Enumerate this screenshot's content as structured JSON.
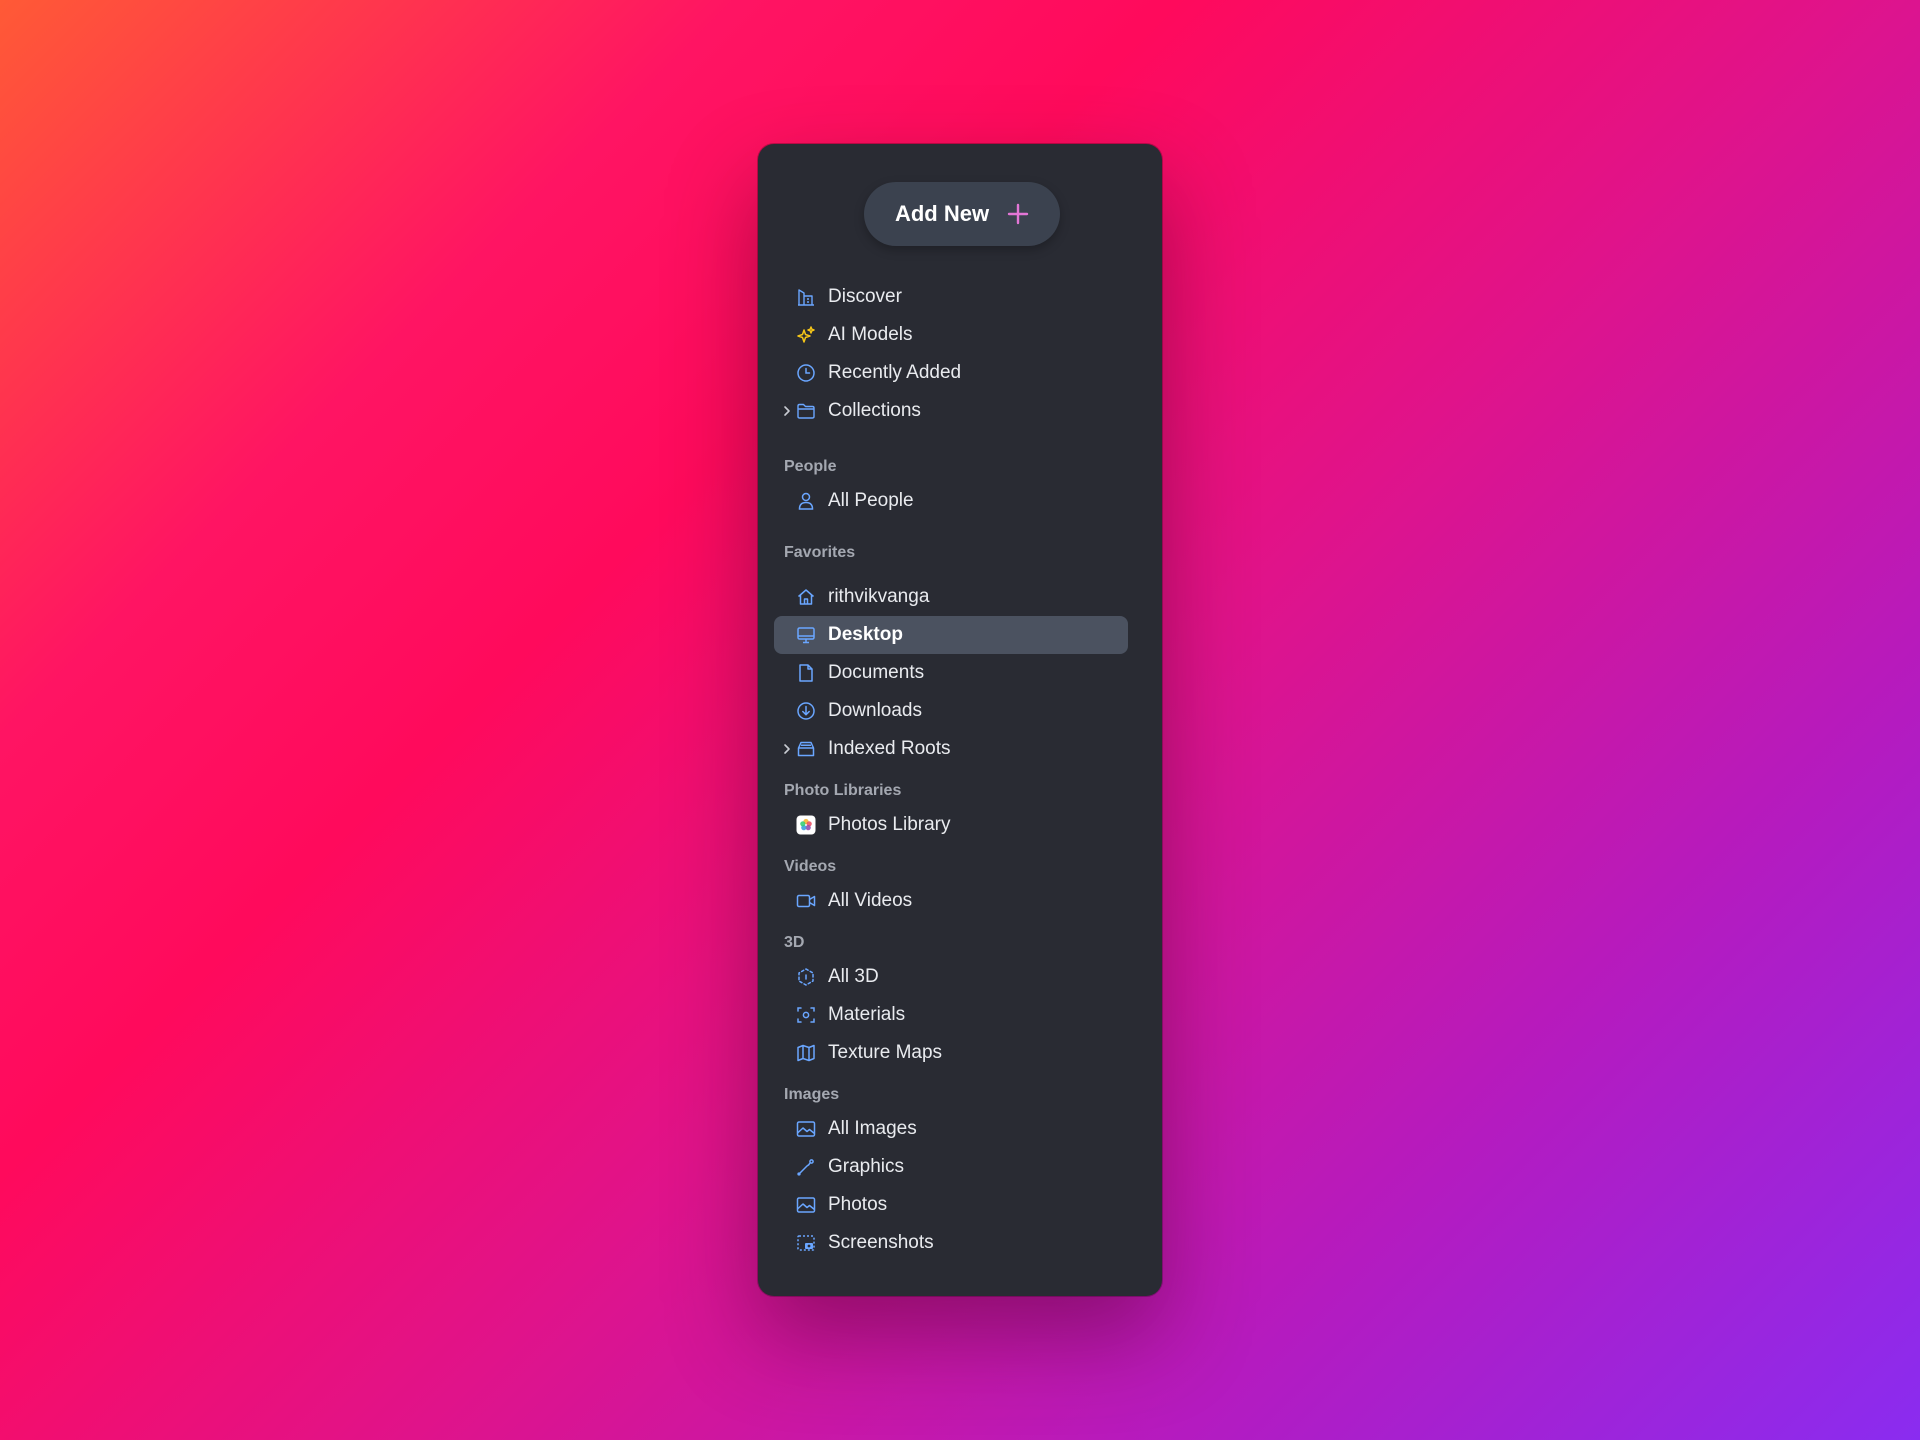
{
  "add_button": {
    "label": "Add New",
    "icon": "plus-icon"
  },
  "colors": {
    "accent_icon": "#6aa6ff",
    "sparkle": "#f5c518",
    "plus": "#e376d6",
    "active_bg": "#4b5260"
  },
  "top_items": [
    {
      "label": "Discover",
      "icon": "building-icon"
    },
    {
      "label": "AI Models",
      "icon": "sparkles-icon"
    },
    {
      "label": "Recently Added",
      "icon": "clock-icon"
    },
    {
      "label": "Collections",
      "icon": "folder-icon",
      "expandable": true
    }
  ],
  "sections": {
    "people": {
      "title": "People",
      "items": [
        {
          "label": "All People",
          "icon": "person-icon"
        }
      ]
    },
    "favorites": {
      "title": "Favorites",
      "items": [
        {
          "label": "rithvikvanga",
          "icon": "home-icon"
        },
        {
          "label": "Desktop",
          "icon": "monitor-icon",
          "selected": true
        },
        {
          "label": "Documents",
          "icon": "document-icon"
        },
        {
          "label": "Downloads",
          "icon": "download-icon"
        },
        {
          "label": "Indexed Roots",
          "icon": "drive-icon",
          "expandable": true
        }
      ]
    },
    "photo_libraries": {
      "title": "Photo Libraries",
      "items": [
        {
          "label": "Photos Library",
          "icon": "photos-app-icon"
        }
      ]
    },
    "videos": {
      "title": "Videos",
      "items": [
        {
          "label": "All Videos",
          "icon": "video-camera-icon"
        }
      ]
    },
    "three_d": {
      "title": "3D",
      "items": [
        {
          "label": "All 3D",
          "icon": "cube-dashed-icon"
        },
        {
          "label": "Materials",
          "icon": "focus-icon"
        },
        {
          "label": "Texture Maps",
          "icon": "map-icon"
        }
      ]
    },
    "images": {
      "title": "Images",
      "items": [
        {
          "label": "All Images",
          "icon": "image-icon"
        },
        {
          "label": "Graphics",
          "icon": "pen-tool-icon"
        },
        {
          "label": "Photos",
          "icon": "photo-icon"
        },
        {
          "label": "Screenshots",
          "icon": "screenshot-icon"
        }
      ]
    }
  }
}
